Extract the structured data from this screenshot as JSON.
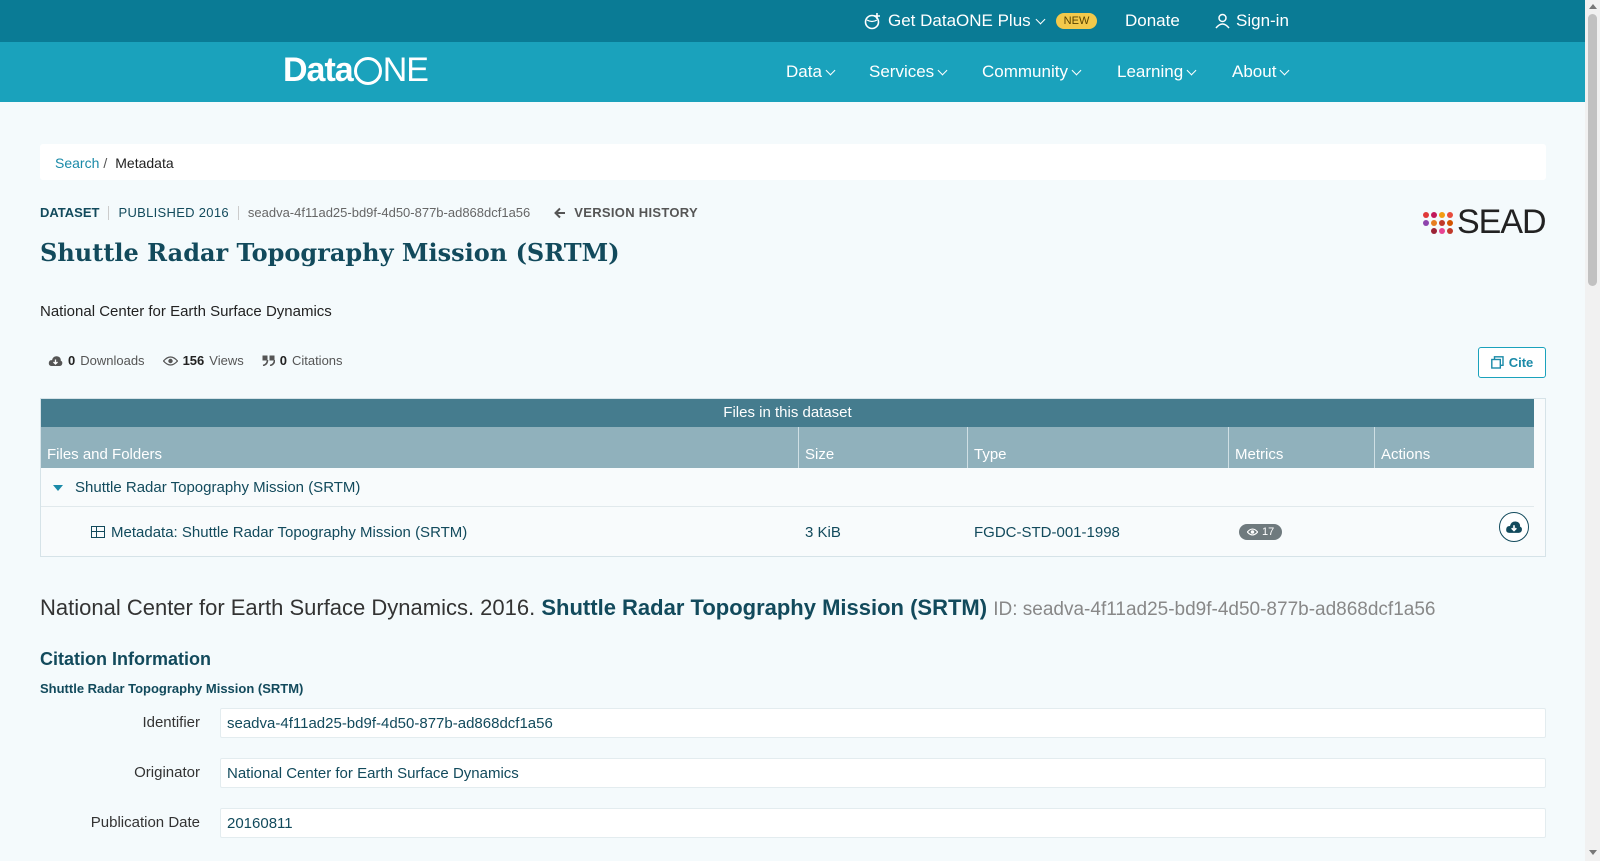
{
  "topbar": {
    "plus_label": "Get DataONE Plus",
    "new_badge": "NEW",
    "donate_label": "Donate",
    "signin_label": "Sign-in"
  },
  "nav": {
    "logo_prefix": "Data",
    "logo_suffix": "NE",
    "items": [
      "Data",
      "Services",
      "Community",
      "Learning",
      "About"
    ]
  },
  "breadcrumb": {
    "search": "Search",
    "separator": "/",
    "current": "Metadata"
  },
  "dataset": {
    "type_label": "DATASET",
    "published": "PUBLISHED 2016",
    "pid": "seadva-4f11ad25-bd9f-4d50-877b-ad868dcf1a56",
    "version_history": "VERSION HISTORY",
    "repo_logo": "SEAD",
    "title": "Shuttle Radar Topography Mission (SRTM)",
    "organization": "National Center for Earth Surface Dynamics"
  },
  "stats": {
    "downloads_count": "0",
    "downloads_label": "Downloads",
    "views_count": "156",
    "views_label": "Views",
    "citations_count": "0",
    "citations_label": "Citations"
  },
  "cite_label": "Cite",
  "files": {
    "header": "Files in this dataset",
    "columns": [
      "Files and Folders",
      "Size",
      "Type",
      "Metrics",
      "Actions"
    ],
    "folder_name": "Shuttle Radar Topography Mission (SRTM)",
    "rows": [
      {
        "name": "Metadata: Shuttle Radar Topography Mission (SRTM)",
        "size": "3 KiB",
        "type": "FGDC-STD-001-1998",
        "views": "17"
      }
    ]
  },
  "citation": {
    "authors": "National Center for Earth Surface Dynamics. 2016.",
    "title": "Shuttle Radar Topography Mission (SRTM)",
    "id": "ID: seadva-4f11ad25-bd9f-4d50-877b-ad868dcf1a56"
  },
  "citation_info": {
    "heading": "Citation Information",
    "subheading": "Shuttle Radar Topography Mission (SRTM)",
    "fields": [
      {
        "label": "Identifier",
        "value": "seadva-4f11ad25-bd9f-4d50-877b-ad868dcf1a56"
      },
      {
        "label": "Originator",
        "value": "National Center for Earth Surface Dynamics"
      },
      {
        "label": "Publication Date",
        "value": "20160811"
      }
    ]
  },
  "colors": {
    "topbar": "#0a7b95",
    "navbar": "#1aa2bc",
    "primary_text": "#124a5c",
    "link": "#1a8aa8",
    "badge": "#f3c94b"
  }
}
